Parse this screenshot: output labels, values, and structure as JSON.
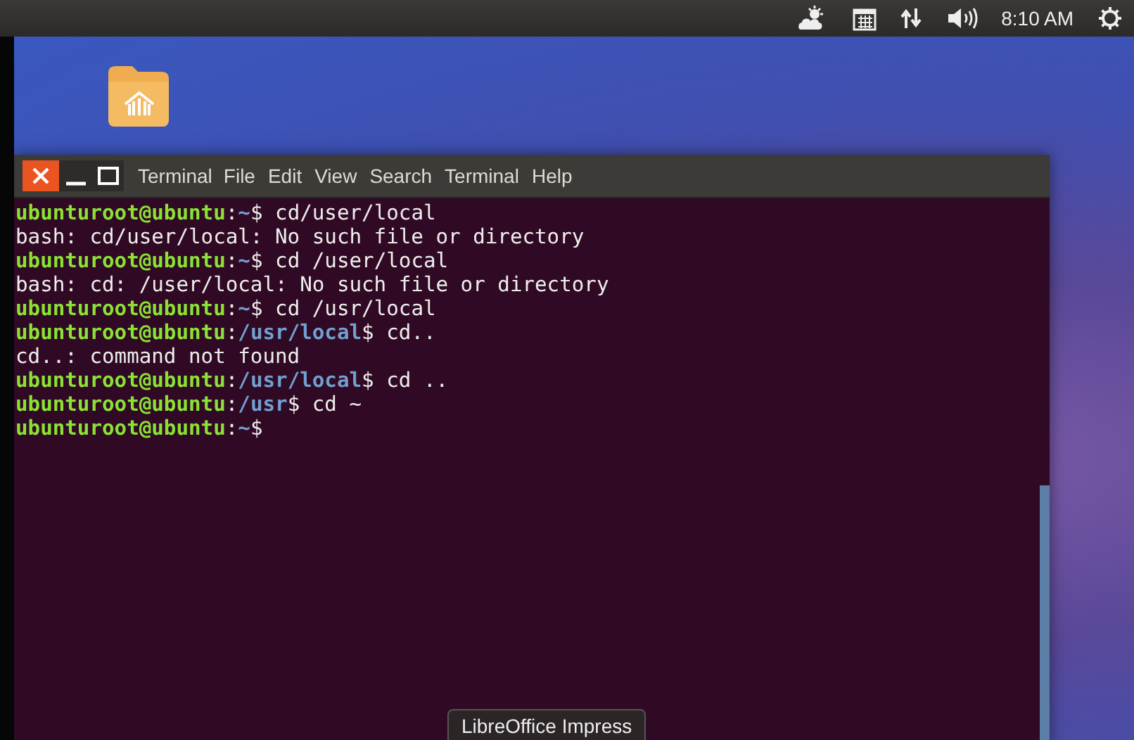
{
  "top_panel": {
    "clock": "8:10 AM"
  },
  "terminal": {
    "app_name": "Terminal",
    "menu": [
      "File",
      "Edit",
      "View",
      "Search",
      "Terminal",
      "Help"
    ],
    "lines": [
      [
        {
          "kind": "user",
          "text": "ubunturoot@ubuntu"
        },
        {
          "kind": "plain",
          "text": ":"
        },
        {
          "kind": "path",
          "text": "~"
        },
        {
          "kind": "plain",
          "text": "$ cd/user/local"
        }
      ],
      [
        {
          "kind": "plain",
          "text": "bash: cd/user/local: No such file or directory"
        }
      ],
      [
        {
          "kind": "user",
          "text": "ubunturoot@ubuntu"
        },
        {
          "kind": "plain",
          "text": ":"
        },
        {
          "kind": "path",
          "text": "~"
        },
        {
          "kind": "plain",
          "text": "$ cd /user/local"
        }
      ],
      [
        {
          "kind": "plain",
          "text": "bash: cd: /user/local: No such file or directory"
        }
      ],
      [
        {
          "kind": "user",
          "text": "ubunturoot@ubuntu"
        },
        {
          "kind": "plain",
          "text": ":"
        },
        {
          "kind": "path",
          "text": "~"
        },
        {
          "kind": "plain",
          "text": "$ cd /usr/local"
        }
      ],
      [
        {
          "kind": "user",
          "text": "ubunturoot@ubuntu"
        },
        {
          "kind": "plain",
          "text": ":"
        },
        {
          "kind": "path",
          "text": "/usr/local"
        },
        {
          "kind": "plain",
          "text": "$ cd.."
        }
      ],
      [
        {
          "kind": "plain",
          "text": "cd..: command not found"
        }
      ],
      [
        {
          "kind": "user",
          "text": "ubunturoot@ubuntu"
        },
        {
          "kind": "plain",
          "text": ":"
        },
        {
          "kind": "path",
          "text": "/usr/local"
        },
        {
          "kind": "plain",
          "text": "$ cd .."
        }
      ],
      [
        {
          "kind": "user",
          "text": "ubunturoot@ubuntu"
        },
        {
          "kind": "plain",
          "text": ":"
        },
        {
          "kind": "path",
          "text": "/usr"
        },
        {
          "kind": "plain",
          "text": "$ cd ~"
        }
      ],
      [
        {
          "kind": "user",
          "text": "ubunturoot@ubuntu"
        },
        {
          "kind": "plain",
          "text": ":"
        },
        {
          "kind": "path",
          "text": "~"
        },
        {
          "kind": "plain",
          "text": "$"
        }
      ]
    ]
  },
  "tooltip": "LibreOffice Impress"
}
